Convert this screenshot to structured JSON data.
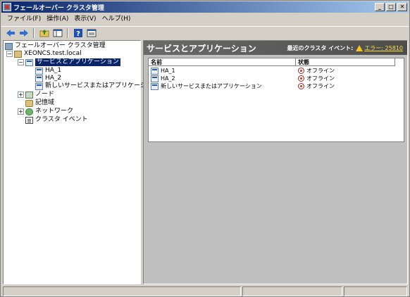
{
  "window": {
    "title": "フェールオーバー クラスタ管理"
  },
  "window_buttons": [
    "_",
    "□",
    "✕"
  ],
  "menu": [
    "ファイル(F)",
    "操作(A)",
    "表示(V)",
    "ヘルプ(H)"
  ],
  "toolbar": {
    "back_icon": "back-arrow-icon",
    "forward_icon": "forward-arrow-icon",
    "up_icon": "up-folder-icon",
    "show_hide_icon": "console-tree-icon",
    "help_icon": "help-icon",
    "props_icon": "properties-icon"
  },
  "tree": {
    "root": "フェールオーバー クラスタ管理",
    "cluster": "XEONCS.test.local",
    "services": "サービスとアプリケーション",
    "service_items": [
      "HA_1",
      "HA_2",
      "新しいサービスまたはアプリケーション"
    ],
    "nodes": "ノード",
    "storage": "記憶域",
    "networks": "ネットワーク",
    "events": "クラスタ イベント"
  },
  "content": {
    "title": "サービスとアプリケーション",
    "recent_events_label": "最近のクラスタ イベント:",
    "recent_events_link": "エラー: 25810",
    "columns": {
      "name": "名前",
      "status": "状態"
    },
    "rows": [
      {
        "name": "HA_1",
        "status": "オフライン"
      },
      {
        "name": "HA_2",
        "status": "オフライン"
      },
      {
        "name": "新しいサービスまたはアプリケーション",
        "status": "オフライン"
      }
    ]
  },
  "colors": {
    "titlebar_start": "#0a246a",
    "selection": "#0a246a",
    "header_bg": "#5a5a5a",
    "offline_red": "#c0392b",
    "warning_yellow": "#f5c518"
  }
}
